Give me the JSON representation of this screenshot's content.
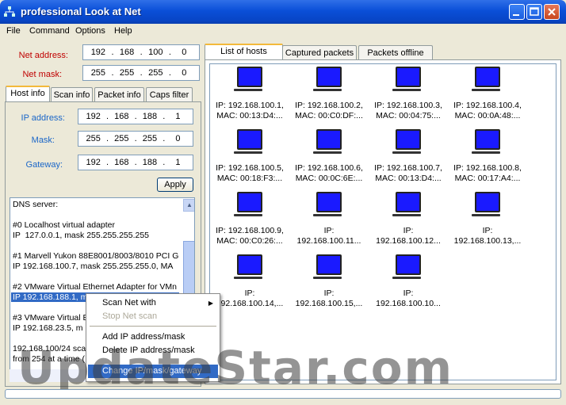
{
  "window": {
    "title": "professional Look at Net"
  },
  "menu": [
    "File",
    "Command",
    "Options",
    "Help"
  ],
  "top_fields": {
    "net_address_label": "Net address:",
    "net_address": [
      "192",
      "168",
      "100",
      "0"
    ],
    "net_mask_label": "Net mask:",
    "net_mask": [
      "255",
      "255",
      "255",
      "0"
    ]
  },
  "left_tabs": [
    "Host info",
    "Scan info",
    "Packet info",
    "Caps filter"
  ],
  "host_info": {
    "ip_label": "IP address:",
    "ip": [
      "192",
      "168",
      "188",
      "1"
    ],
    "mask_label": "Mask:",
    "mask": [
      "255",
      "255",
      "255",
      "0"
    ],
    "gateway_label": "Gateway:",
    "gateway": [
      "192",
      "168",
      "188",
      "1"
    ],
    "apply_label": "Apply"
  },
  "info_lines": [
    "DNS server:",
    "",
    "#0 Localhost virtual adapter",
    "IP  127.0.0.1, mask 255.255.255.255",
    "",
    "#1 Marvell Yukon 88E8001/8003/8010 PCI G",
    "IP 192.168.100.7, mask 255.255.255.0, MA",
    "",
    "#2 VMware Virtual Ethernet Adapter for VMn",
    "IP 192.168.188.1, mask 255.255.255.0, MA",
    "",
    "#3 VMware Virtual E",
    "IP 192.168.23.5, m",
    "",
    "192.168.100/24 sca",
    "from 254 at a time ("
  ],
  "right_tabs": [
    "List of hosts",
    "Captured packets",
    "Packets offline"
  ],
  "hosts": [
    {
      "line1": "IP: 192.168.100.1,",
      "line2": "MAC: 00:13:D4:..."
    },
    {
      "line1": "IP: 192.168.100.2,",
      "line2": "MAC: 00:C0:DF:..."
    },
    {
      "line1": "IP: 192.168.100.3,",
      "line2": "MAC: 00:04:75:..."
    },
    {
      "line1": "IP: 192.168.100.4,",
      "line2": "MAC: 00:0A:48:..."
    },
    {
      "line1": "IP: 192.168.100.5,",
      "line2": "MAC: 00:18:F3:..."
    },
    {
      "line1": "IP: 192.168.100.6,",
      "line2": "MAC: 00:0C:6E:..."
    },
    {
      "line1": "IP: 192.168.100.7,",
      "line2": "MAC: 00:13:D4:..."
    },
    {
      "line1": "IP: 192.168.100.8,",
      "line2": "MAC: 00:17:A4:..."
    },
    {
      "line1": "IP: 192.168.100.9,",
      "line2": "MAC: 00:C0:26:..."
    },
    {
      "line1": "IP:",
      "line2": "192.168.100.11..."
    },
    {
      "line1": "IP:",
      "line2": "192.168.100.12..."
    },
    {
      "line1": "IP:",
      "line2": "192.168.100.13,..."
    },
    {
      "line1": "IP:",
      "line2": "192.168.100.14,..."
    },
    {
      "line1": "IP:",
      "line2": "192.168.100.15,..."
    },
    {
      "line1": "IP:",
      "line2": "192.168.100.10..."
    }
  ],
  "context_menu": {
    "scan_net_with": "Scan Net with",
    "stop_net_scan": "Stop Net scan",
    "add_ip_mask": "Add IP address/mask",
    "delete_ip_mask": "Delete IP address/mask",
    "change_ip": "Change IP/mask/gateway"
  },
  "watermark": "UpdateStar.com",
  "colors": {
    "title_blue": "#0a4fd8",
    "label_red": "#c00000",
    "label_blue": "#1a66c8",
    "monitor_blue": "#1a1aff",
    "selection": "#316ac5"
  }
}
